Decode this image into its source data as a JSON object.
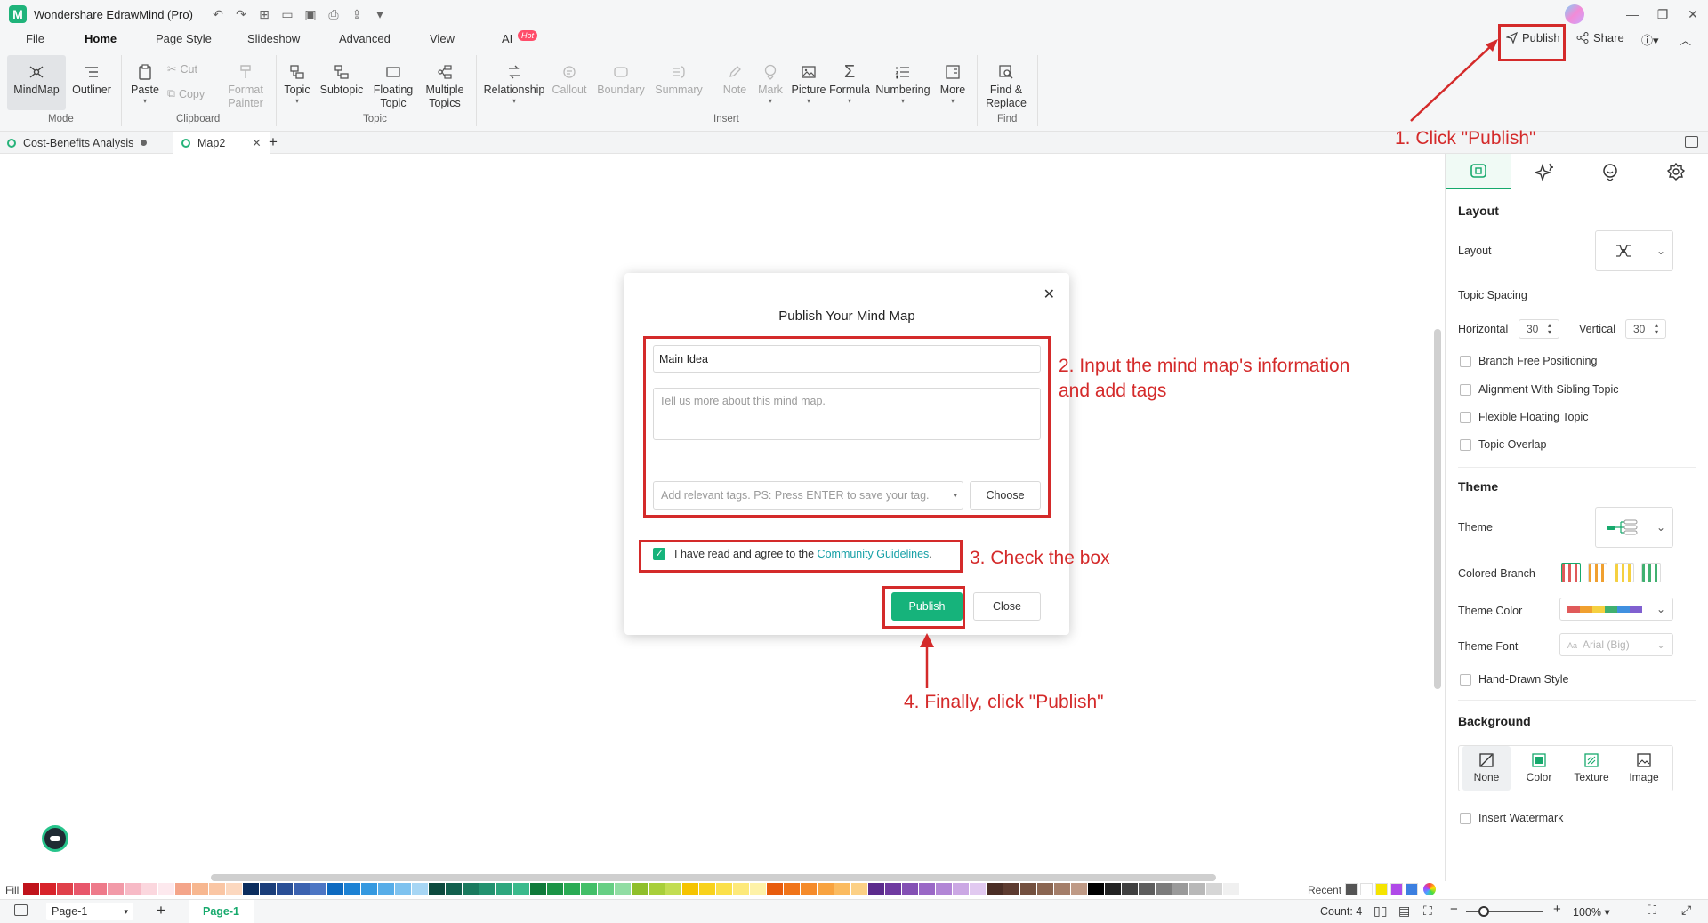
{
  "app": {
    "title": "Wondershare EdrawMind (Pro)",
    "logo_icon": "edrawmind-logo-icon"
  },
  "menu": {
    "items": [
      "File",
      "Home",
      "Page Style",
      "Slideshow",
      "Advanced",
      "View",
      "AI"
    ],
    "active": "Home",
    "ai_badge": "Hot",
    "publish_label": "Publish",
    "share_label": "Share"
  },
  "ribbon": {
    "mode": {
      "mindmap": "MindMap",
      "outliner": "Outliner",
      "group": "Mode"
    },
    "clipboard": {
      "paste": "Paste",
      "cut": "Cut",
      "copy": "Copy",
      "format_painter": [
        "Format",
        "Painter"
      ],
      "group": "Clipboard"
    },
    "topic": {
      "topic": "Topic",
      "subtopic": "Subtopic",
      "floating": [
        "Floating",
        "Topic"
      ],
      "multiple": [
        "Multiple",
        "Topics"
      ],
      "group": "Topic"
    },
    "insert": {
      "relationship": "Relationship",
      "callout": "Callout",
      "boundary": "Boundary",
      "summary": "Summary",
      "note": "Note",
      "mark": "Mark",
      "picture": "Picture",
      "formula": "Formula",
      "numbering": "Numbering",
      "more": "More",
      "group": "Insert"
    },
    "find": {
      "find_replace": [
        "Find &",
        "Replace"
      ],
      "group": "Find"
    }
  },
  "tabs": [
    {
      "label": "Cost-Benefits Analysis",
      "active": false
    },
    {
      "label": "Map2",
      "active": true
    }
  ],
  "dialog": {
    "title": "Publish Your Mind Map",
    "title_value": "Main Idea",
    "description_placeholder": "Tell us more about this mind map.",
    "tags_placeholder": "Add relevant tags. PS: Press ENTER to save your tag.",
    "choose_label": "Choose",
    "agree_text": "I have read and agree to the",
    "agree_link": "Community Guidelines",
    "agree_period": ".",
    "agree_checked": true,
    "publish_label": "Publish",
    "close_label": "Close"
  },
  "annotations": {
    "step1": "1. Click \"Publish\"",
    "step2_line1": "2. Input the mind map's information",
    "step2_line2": "and add tags",
    "step3": "3. Check the box",
    "step4": "4. Finally, click \"Publish\"",
    "color": "#d42a2a"
  },
  "panel": {
    "layout_header": "Layout",
    "layout_label": "Layout",
    "topic_spacing": "Topic Spacing",
    "horizontal_label": "Horizontal",
    "horizontal_value": "30",
    "vertical_label": "Vertical",
    "vertical_value": "30",
    "checks": [
      "Branch Free Positioning",
      "Alignment With Sibling Topic",
      "Flexible Floating Topic",
      "Topic Overlap"
    ],
    "theme_header": "Theme",
    "theme_label": "Theme",
    "colored_branch": "Colored Branch",
    "theme_color": "Theme Color",
    "theme_font": "Theme Font",
    "theme_font_value": "Arial (Big)",
    "hand_drawn": "Hand-Drawn Style",
    "background_header": "Background",
    "bg_options": [
      "None",
      "Color",
      "Texture",
      "Image"
    ],
    "insert_watermark": "Insert Watermark"
  },
  "colorbar": {
    "fill_label": "Fill",
    "recent_label": "Recent",
    "swatches": [
      "#c0131b",
      "#d8232a",
      "#e0404a",
      "#e8576b",
      "#ee7a8a",
      "#f29aa8",
      "#f7bac6",
      "#fbd7de",
      "#fde9ee",
      "#f4a58a",
      "#f7b790",
      "#fac6a4",
      "#fcd8bf",
      "#0b2d5e",
      "#1b3e7a",
      "#2a4f96",
      "#3b62b0",
      "#4d76c4",
      "#0e6ac0",
      "#1d82d4",
      "#3599e0",
      "#57ade8",
      "#7ec2ef",
      "#a7d6f4",
      "#0d4a3e",
      "#12604e",
      "#1a7a5e",
      "#23926f",
      "#2ea77e",
      "#3bba8c",
      "#0f7a3a",
      "#1b9446",
      "#2aab54",
      "#43bf68",
      "#67cf84",
      "#91dda3",
      "#8fbf2a",
      "#a8cf3a",
      "#c2dd52",
      "#f5c400",
      "#f8d21c",
      "#fbe04a",
      "#fde97a",
      "#fef2a8",
      "#e85c0d",
      "#f07419",
      "#f58b2a",
      "#f8a340",
      "#fbbb60",
      "#fcd085",
      "#5c2b8c",
      "#6f3aa0",
      "#8450b4",
      "#9a68c6",
      "#b286d6",
      "#cba8e4",
      "#e1c9f0",
      "#4a2d25",
      "#5d3b30",
      "#73503f",
      "#8a6551",
      "#a47e69",
      "#bf9a86",
      "#000000",
      "#222222",
      "#404040",
      "#5e5e5e",
      "#7c7c7c",
      "#9a9a9a",
      "#b8b8b8",
      "#d6d6d6",
      "#f0f0f0"
    ]
  },
  "recent_swatches": [
    "#555555",
    "#ffffff",
    "#f5e400",
    "#b04ae8",
    "#3c7fe0"
  ],
  "status": {
    "page_select": "Page-1",
    "page_tab": "Page-1",
    "count": "Count: 4",
    "zoom": "100%"
  },
  "theme_colors": [
    "#e05a5a",
    "#f0a030",
    "#f5d040",
    "#40b070",
    "#4090e0",
    "#8060d0"
  ],
  "accent": "#16b37b"
}
